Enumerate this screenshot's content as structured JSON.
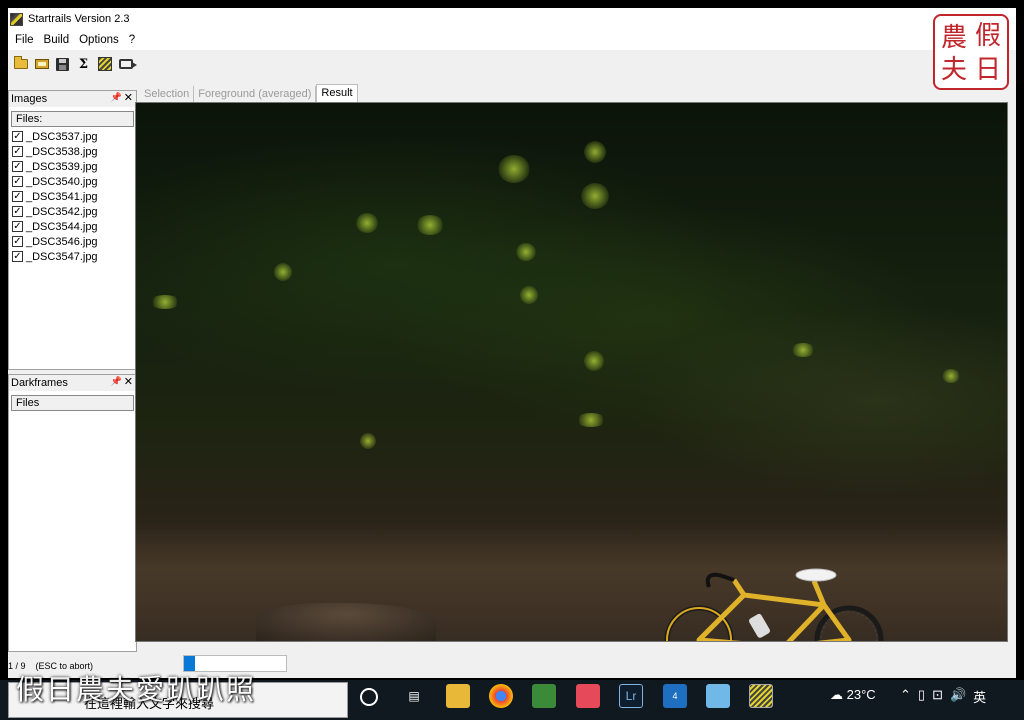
{
  "window": {
    "title": "Startrails Version 2.3"
  },
  "menu": [
    "File",
    "Build",
    "Options",
    "?"
  ],
  "toolbar_icons": [
    "open-folder-icon",
    "open-folder-icon",
    "save-icon",
    "sigma-icon",
    "startrails-icon",
    "video-camera-icon"
  ],
  "images_panel": {
    "title": "Images",
    "files_header": "Files:",
    "files": [
      "_DSC3537.jpg",
      "_DSC3538.jpg",
      "_DSC3539.jpg",
      "_DSC3540.jpg",
      "_DSC3541.jpg",
      "_DSC3542.jpg",
      "_DSC3544.jpg",
      "_DSC3546.jpg",
      "_DSC3547.jpg"
    ]
  },
  "darkframes_panel": {
    "title": "Darkframes",
    "files_header": "Files"
  },
  "tabs": [
    {
      "label": "Selection",
      "active": false
    },
    {
      "label": "Foreground (averaged)",
      "active": false
    },
    {
      "label": "Result",
      "active": true
    }
  ],
  "status": {
    "count": "1 / 9",
    "hint": "(ESC to abort)",
    "progress": 0.111
  },
  "stamp": {
    "chars": [
      "農",
      "假",
      "夫",
      "日"
    ]
  },
  "taskbar": {
    "search_placeholder": "在這裡輸入文字來搜尋",
    "watermark": "假日農夫愛趴趴照",
    "weather": "23°C",
    "ime": "英",
    "badge_count": "4"
  },
  "colors": {
    "progress": "#0a78d7",
    "stamp": "#c0262b",
    "taskbar": "#101820"
  }
}
